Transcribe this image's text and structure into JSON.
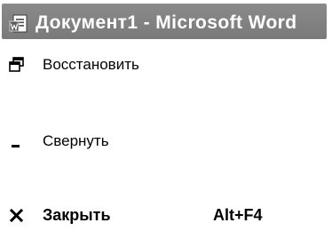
{
  "window": {
    "title": "Документ1 - Microsoft Word",
    "icon": "word-document-icon"
  },
  "menu": {
    "items": [
      {
        "label": "Восстановить",
        "icon": "restore-icon",
        "shortcut": ""
      },
      {
        "label": "Свернуть",
        "icon": "minimize-icon",
        "shortcut": ""
      },
      {
        "label": "Закрыть",
        "icon": "close-icon",
        "shortcut": "Alt+F4"
      }
    ]
  },
  "colors": {
    "titlebar": "#808080",
    "title_text": "#ffffff",
    "background": "#ffffff"
  }
}
